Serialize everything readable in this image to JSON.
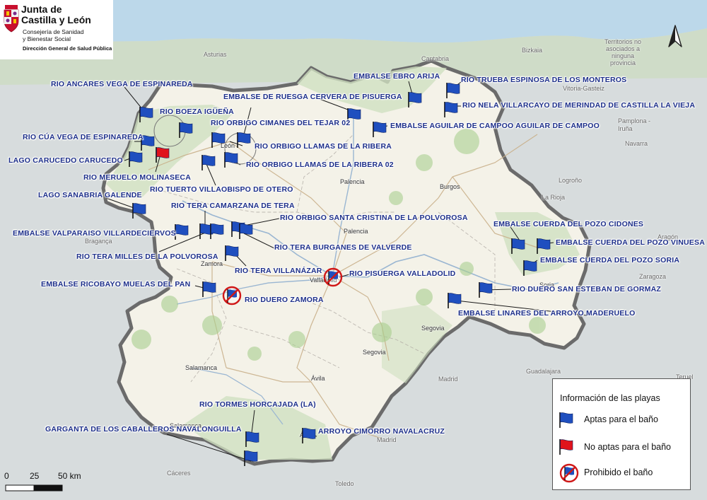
{
  "header": {
    "org_line1": "Junta de",
    "org_line2": "Castilla y León",
    "dept_line1": "Consejería de Sanidad",
    "dept_line2": "y Bienestar Social",
    "dept_line3": "Dirección General de Salud Pública"
  },
  "legend": {
    "title": "Información de las playas",
    "items": [
      {
        "label": "Aptas para el baño",
        "symbol": "blue-flag-icon"
      },
      {
        "label": "No aptas para el baño",
        "symbol": "red-flag-icon"
      },
      {
        "label": "Prohibido el baño",
        "symbol": "prohibited-icon"
      }
    ]
  },
  "scale": {
    "t0": "0",
    "t1": "25",
    "t2": "50 km"
  },
  "colors": {
    "apta": "#1f4fbf",
    "no_apta": "#e0141c",
    "prohibido": "#d01818",
    "label": "#1d2f8a",
    "region": "#f6f4ec",
    "outside": "#d9dde0",
    "border": "#6b6b6b"
  },
  "beaches": {
    "b1": "RIO ANCARES VEGA DE ESPINAREDA",
    "b2": "RIO BOEZA IGÜEÑA",
    "b3": "RIO ORBIGO CIMANES DEL TEJAR 02",
    "b4": "EMBALSE DE RUESGA CERVERA DE PISUERGA",
    "b5": "EMBALSE EBRO ARIJA",
    "b6": "RIO TRUEBA ESPINOSA DE LOS MONTEROS",
    "b7": "RIO NELA VILLARCAYO DE MERINDAD DE CASTILLA LA VIEJA",
    "b8": "EMBALSE AGUILAR DE CAMPOO AGUILAR DE CAMPOO",
    "b9": "RIO CÚA VEGA DE ESPINAREDA",
    "b10": "RIO ORBIGO LLAMAS DE LA RIBERA",
    "b11": "LAGO CARUCEDO CARUCEDO",
    "b12": "RIO ORBIGO LLAMAS DE LA RIBERA 02",
    "b13": "RIO MERUELO MOLINASECA",
    "b14": "RIO TUERTO VILLAOBISPO DE OTERO",
    "b15": "LAGO SANABRIA GALENDE",
    "b16": "RIO TERA CAMARZANA DE TERA",
    "b17": "RIO ORBIGO SANTA CRISTINA DE LA POLVOROSA",
    "b18": "EMBALSE VALPARAISO VILLARDECIERVOS",
    "b19": "RIO TERA MILLES DE LA POLVOROSA",
    "b20": "RIO TERA BURGANES DE VALVERDE",
    "b21": "RIO TERA VILLANÁZAR",
    "b22": "RIO PISUERGA VALLADOLID",
    "b23": "EMBALSE RICOBAYO MUELAS DEL PAN",
    "b24": "RIO DUERO ZAMORA",
    "b25": "EMBALSE CUERDA DEL POZO CIDONES",
    "b26": "EMBALSE CUERDA DEL POZO VINUESA",
    "b27": "EMBALSE CUERDA DEL POZO SORIA",
    "b28": "RIO DUERO SAN ESTEBAN DE GORMAZ",
    "b29": "EMBALSE LINARES DEL ARROYO MADERUELO",
    "b30": "RIO TORMES HORCAJADA (LA)",
    "b31": "GARGANTA DE LOS CABALLEROS NAVALONGUILLA",
    "b32": "ARROYO CIMORRO NAVALACRUZ"
  },
  "places": {
    "p1": "Asturias",
    "p2": "Cantabria",
    "p3": "Bizkaia",
    "p4": "León",
    "p5": "Palencia",
    "p6": "Burgos",
    "p7": "La Rioja",
    "p8": "Palencia",
    "p9": "Zamora",
    "p10": "Valladolid",
    "p11": "Soria",
    "p12": "Segovia",
    "p13": "Segovia",
    "p14": "Salamanca",
    "p15": "Salamanca",
    "p16": "Ávila",
    "p17": "Ávila",
    "p18": "Madrid",
    "p19": "Guadalajara",
    "p20": "Teruel",
    "p21": "Zaragoza",
    "p22": "Navarra",
    "p23": "Pamplona - Iruña",
    "p24": "Cáceres",
    "p25": "Toledo",
    "p26": "Madrid",
    "p27": "Territorios no asociados a ninguna provincia",
    "p28": "Vitoria-Gasteiz",
    "p29": "Logroño",
    "p30": "Bragança",
    "p31": "Aragón"
  }
}
